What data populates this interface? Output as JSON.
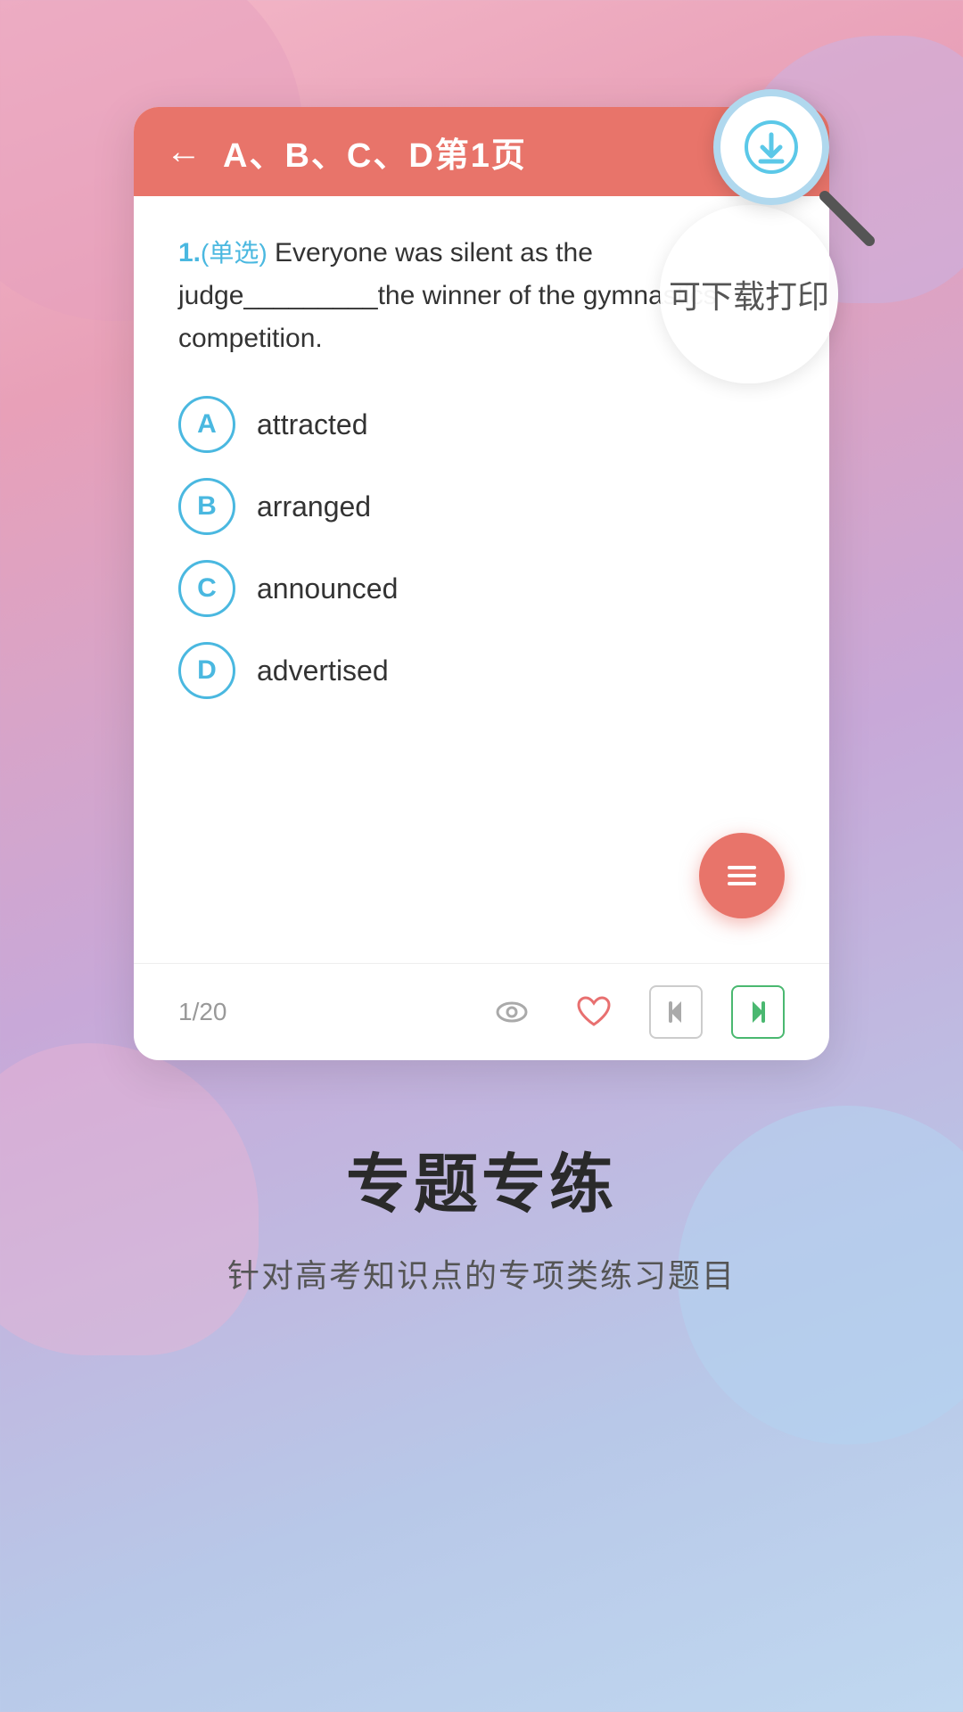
{
  "header": {
    "back_label": "←",
    "title": "A、B、C、D第1页",
    "download_tooltip": "可下载打印"
  },
  "question": {
    "number": "1.",
    "type": "(单选)",
    "text": " Everyone was silent as the judge_________the winner of the gymnastics competition."
  },
  "options": [
    {
      "id": "A",
      "text": "attracted"
    },
    {
      "id": "B",
      "text": "arranged"
    },
    {
      "id": "C",
      "text": "announced"
    },
    {
      "id": "D",
      "text": "advertised"
    }
  ],
  "footer": {
    "page_label": "1/20"
  },
  "bottom": {
    "title": "专题专练",
    "subtitle": "针对高考知识点的专项类练习题目"
  }
}
